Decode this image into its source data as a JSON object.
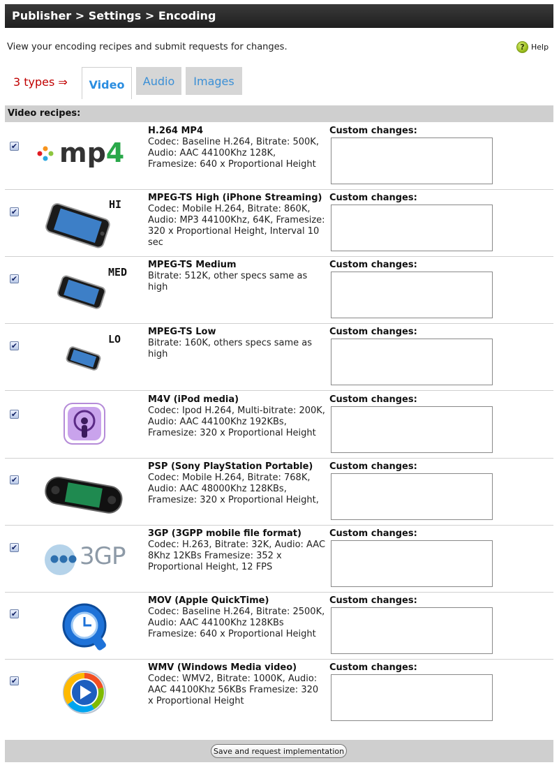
{
  "header": {
    "breadcrumb": "Publisher > Settings > Encoding"
  },
  "intro": "View your encoding recipes and submit requests for changes.",
  "help": {
    "label": "Help",
    "icon": "question-help-icon",
    "icon_glyph": "?"
  },
  "types_label": "3 types ⇒",
  "tabs": [
    {
      "label": "Video",
      "active": true
    },
    {
      "label": "Audio",
      "active": false
    },
    {
      "label": "Images",
      "active": false
    }
  ],
  "section_title": "Video recipes:",
  "check_glyph": "✔",
  "custom_label": "Custom changes:",
  "recipes": [
    {
      "name": "H.264 MP4",
      "desc": "Codec: Baseline H.264, Bitrate: 500K, Audio: AAC 44100Khz 128K, Framesize: 640 x Proportional Height",
      "logo": "mp4-logo",
      "checked": true
    },
    {
      "name": "MPEG-TS High (iPhone Streaming)",
      "desc": "Codec: Mobile H.264, Bitrate: 860K, Audio: MP3 44100Khz, 64K, Framesize: 320 x Proportional Height, Interval 10 sec",
      "logo": "iphone-icon",
      "phone_label": "HI",
      "checked": true
    },
    {
      "name": "MPEG-TS Medium",
      "desc": "Bitrate: 512K, other specs same as high",
      "logo": "iphone-icon",
      "phone_label": "MED",
      "checked": true
    },
    {
      "name": "MPEG-TS Low",
      "desc": "Bitrate: 160K, others specs same as high",
      "logo": "iphone-icon",
      "phone_label": "LO",
      "checked": true
    },
    {
      "name": "M4V (iPod media)",
      "desc": "Codec: Ipod H.264, Multi-bitrate: 200K, Audio: AAC 44100Khz 192KBs, Framesize: 320 x Proportional Height",
      "logo": "podcast-icon",
      "checked": true
    },
    {
      "name": "PSP (Sony PlayStation Portable)",
      "desc": "Codec: Mobile H.264, Bitrate: 768K, Audio: AAC 48000Khz 128KBs, Framesize: 320 x Proportional Height,",
      "logo": "psp-icon",
      "checked": true
    },
    {
      "name": "3GP (3GPP mobile file format)",
      "desc": "Codec: H.263, Bitrate: 32K, Audio: AAC 8Khz 12KBs Framesize: 352 x Proportional Height, 12 FPS",
      "logo": "3gp-logo",
      "logo_text": "3GP",
      "checked": true
    },
    {
      "name": "MOV (Apple QuickTime)",
      "desc": "Codec: Baseline H.264, Bitrate: 2500K, Audio: AAC 44100Khz 128KBs Framesize: 640 x Proportional Height",
      "logo": "quicktime-icon",
      "checked": true
    },
    {
      "name": "WMV (Windows Media video)",
      "desc": "Codec: WMV2, Bitrate: 1000K, Audio: AAC 44100Khz 56KBs Framesize: 320 x Proportional Height",
      "logo": "windows-media-icon",
      "checked": true
    }
  ],
  "mp4_logo_text": "mp4",
  "save_button": "Save and request implementation"
}
